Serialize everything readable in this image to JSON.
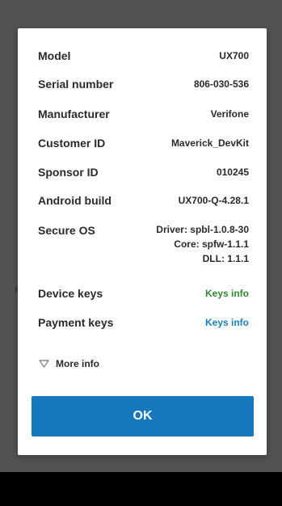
{
  "rows": [
    {
      "label": "Model",
      "value": "UX700"
    },
    {
      "label": "Serial number",
      "value": "806-030-536"
    },
    {
      "label": "Manufacturer",
      "value": "Verifone"
    },
    {
      "label": "Customer ID",
      "value": "Maverick_DevKit"
    },
    {
      "label": "Sponsor ID",
      "value": "010245"
    },
    {
      "label": "Android build",
      "value": "UX700-Q-4.28.1"
    }
  ],
  "secure_os": {
    "label": "Secure OS",
    "driver": "Driver: spbl-1.0.8-30",
    "core": "Core: spfw-1.1.1",
    "dll": "DLL: 1.1.1"
  },
  "device_keys": {
    "label": "Device keys",
    "value": "Keys info"
  },
  "payment_keys": {
    "label": "Payment keys",
    "value": "Keys info"
  },
  "more_info": {
    "label": "More info",
    "icon": "chevron-down-icon"
  },
  "ok_button": {
    "label": "OK"
  },
  "colors": {
    "accent": "#1577bc",
    "device_keys_link": "#2e8b2e",
    "payment_keys_link": "#1a7fc2"
  }
}
